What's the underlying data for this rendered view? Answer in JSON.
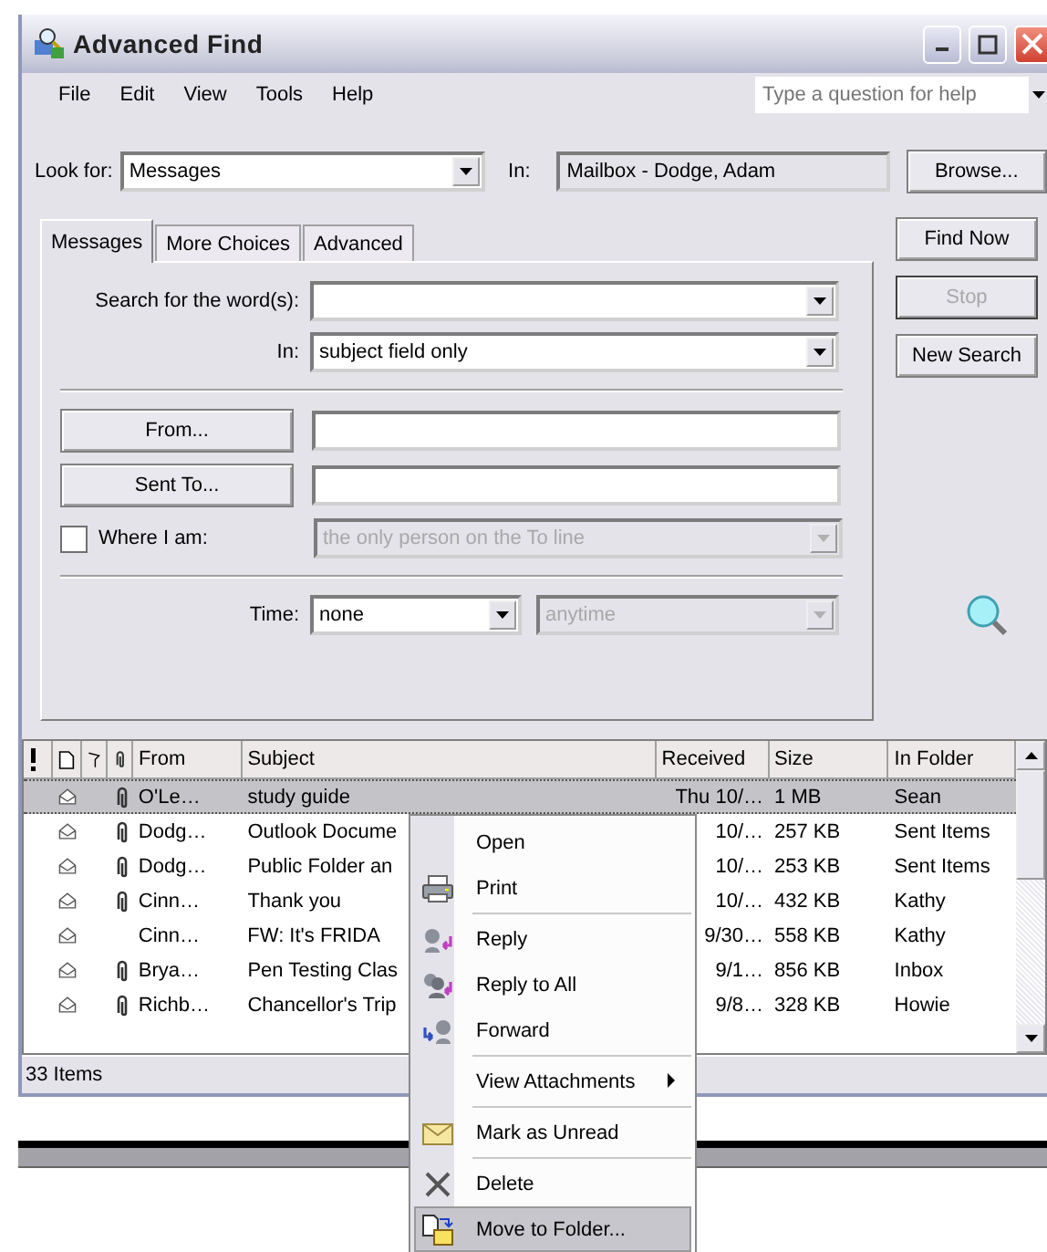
{
  "window": {
    "title": "Advanced Find"
  },
  "menu_bar": [
    "File",
    "Edit",
    "View",
    "Tools",
    "Help"
  ],
  "help_box": {
    "placeholder": "Type a question for help"
  },
  "look_for": {
    "label": "Look for:",
    "value": "Messages"
  },
  "look_in": {
    "label": "In:",
    "value": "Mailbox - Dodge, Adam"
  },
  "browse_button": "Browse...",
  "side_buttons": [
    {
      "label": "Find Now",
      "disabled": false
    },
    {
      "label": "Stop",
      "disabled": true
    },
    {
      "label": "New Search",
      "disabled": false
    }
  ],
  "tabs": [
    {
      "label": "Messages",
      "selected": true
    },
    {
      "label": "More Choices",
      "selected": false
    },
    {
      "label": "Advanced",
      "selected": false
    }
  ],
  "search_words": {
    "label": "Search for the word(s):"
  },
  "search_in": {
    "label": "In:",
    "value": "subject field only"
  },
  "from_button": "From...",
  "sent_to_button": "Sent To...",
  "where_i_am": {
    "label": "Where I am:",
    "checked": false,
    "value": "the only person on the To line",
    "disabled": true
  },
  "time": {
    "label": "Time:",
    "value": "none",
    "range": {
      "value": "anytime",
      "disabled": true
    }
  },
  "results": {
    "columns": [
      "From",
      "Subject",
      "Received",
      "Size",
      "In Folder"
    ],
    "rows": [
      {
        "from": "O'Le…",
        "subject": "study guide",
        "received": "Thu 10/…",
        "size": "1 MB",
        "folder": "Sean",
        "attachment": true,
        "selected": true
      },
      {
        "from": "Dodg…",
        "subject": "Outlook Docume",
        "received": "10/…",
        "size": "257 KB",
        "folder": "Sent Items",
        "attachment": true,
        "selected": false
      },
      {
        "from": "Dodg…",
        "subject": "Public Folder an",
        "received": "10/…",
        "size": "253 KB",
        "folder": "Sent Items",
        "attachment": true,
        "selected": false
      },
      {
        "from": "Cinn…",
        "subject": "Thank you",
        "received": "10/…",
        "size": "432 KB",
        "folder": "Kathy",
        "attachment": true,
        "selected": false
      },
      {
        "from": "Cinn…",
        "subject": "FW: It's FRIDA",
        "received": "9/30…",
        "size": "558 KB",
        "folder": "Kathy",
        "attachment": false,
        "selected": false
      },
      {
        "from": "Brya…",
        "subject": "Pen Testing Clas",
        "received": "9/1…",
        "size": "856 KB",
        "folder": "Inbox",
        "attachment": true,
        "selected": false
      },
      {
        "from": "Richb…",
        "subject": "Chancellor's Trip",
        "received": "9/8…",
        "size": "328 KB",
        "folder": "Howie",
        "attachment": true,
        "selected": false
      }
    ]
  },
  "status_bar": "33 Items",
  "context_menu": [
    {
      "kind": "item",
      "label": "Open",
      "selected": false
    },
    {
      "kind": "item",
      "label": "Print",
      "selected": false
    },
    {
      "kind": "separator"
    },
    {
      "kind": "item",
      "label": "Reply",
      "selected": false
    },
    {
      "kind": "item",
      "label": "Reply to All",
      "selected": false
    },
    {
      "kind": "item",
      "label": "Forward",
      "selected": false
    },
    {
      "kind": "separator"
    },
    {
      "kind": "submenu",
      "label": "View Attachments",
      "selected": false
    },
    {
      "kind": "separator"
    },
    {
      "kind": "item",
      "label": "Mark as Unread",
      "selected": false
    },
    {
      "kind": "separator"
    },
    {
      "kind": "item",
      "label": "Delete",
      "selected": false
    },
    {
      "kind": "item",
      "label": "Move to Folder...",
      "selected": true
    }
  ]
}
